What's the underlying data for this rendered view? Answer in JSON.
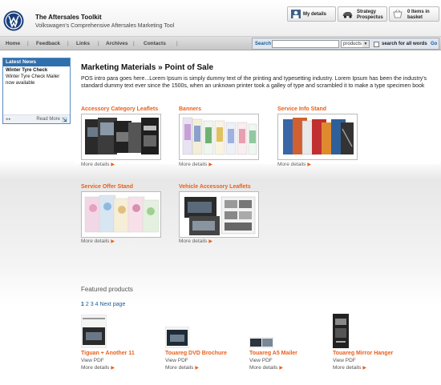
{
  "header": {
    "title": "The Aftersales Toolkit",
    "subtitle": "Volkswagen's Comprehensive Aftersales Marketing Tool",
    "buttons": [
      {
        "label": "My details",
        "icon": "user-icon"
      },
      {
        "label": "Strategy Prospectus",
        "icon": "car-icon"
      },
      {
        "label": "0 Items in basket",
        "icon": "basket-icon"
      }
    ]
  },
  "nav": {
    "items": [
      "Home",
      "Feedback",
      "Links",
      "Archives",
      "Contacts"
    ],
    "separator": "|"
  },
  "search": {
    "label": "Search",
    "value": "",
    "select_value": "products",
    "checkbox_label": "search for all words",
    "go_label": "Go"
  },
  "news": {
    "heading": "Latest News",
    "title": "Winter Tyre Check",
    "body": "Winter Tyre Check Mailer now available",
    "arrows": "◂ ▸",
    "read_more": "Read More"
  },
  "main": {
    "title": "Marketing Materials » Point of Sale",
    "intro": "POS intro para goes here...Lorem Ipsum is simply dummy text of the printing and typesetting industry. Lorem Ipsum has been the industry's standard dummy text ever since the 1500s, when an unknown printer took a galley of type and scrambled it to make a type specimen book",
    "more_label": "More details",
    "categories": [
      {
        "title": "Accessory Category Leaflets"
      },
      {
        "title": "Banners"
      },
      {
        "title": "Service Info Stand"
      },
      {
        "title": "Service Offer Stand"
      },
      {
        "title": "Vehicle Accessory Leaflets"
      }
    ]
  },
  "featured": {
    "heading": "Featured products",
    "pages": [
      "1",
      "2",
      "3",
      "4"
    ],
    "next_label": "Next page",
    "view_pdf": "View PDF",
    "more_label": "More details",
    "products": [
      {
        "title": "Tiguan + Another 11"
      },
      {
        "title": "Touareg DVD Brochure"
      },
      {
        "title": "Touareg A5 Mailer"
      },
      {
        "title": "Touareg Mirror Hanger"
      }
    ]
  },
  "colors": {
    "accent": "#e8601c",
    "link": "#1a5a9a",
    "news_header": "#2e6fae"
  }
}
